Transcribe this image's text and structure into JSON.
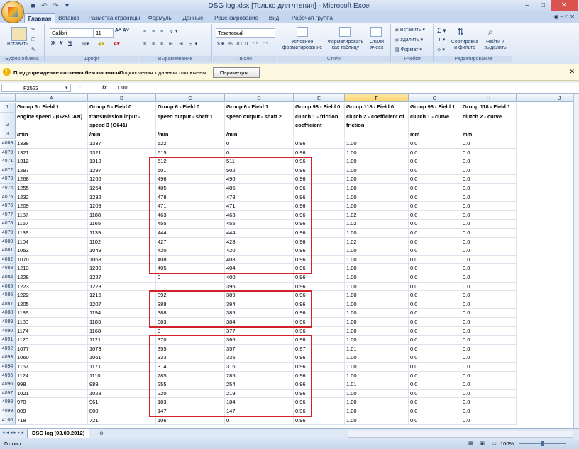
{
  "window": {
    "title": "DSG log.xlsx  [Только для чтения]  -  Microsoft Excel"
  },
  "ribbon_tabs": [
    "Главная",
    "Вставка",
    "Разметка страницы",
    "Формулы",
    "Данные",
    "Рецензирование",
    "Вид",
    "Рабочая группа"
  ],
  "ribbon": {
    "clipboard": {
      "label": "Буфер обмена",
      "paste": "Вставить"
    },
    "font": {
      "label": "Шрифт",
      "name": "Calibri",
      "size": "11"
    },
    "alignment": {
      "label": "Выравнивание"
    },
    "number": {
      "label": "Число",
      "format": "Текстовый"
    },
    "styles": {
      "label": "Стили",
      "cond": "Условное форматирование",
      "table": "Форматировать как таблицу",
      "cell": "Стили ячеек"
    },
    "cells": {
      "label": "Ячейки",
      "insert": "Вставить",
      "delete": "Удалить",
      "format": "Формат"
    },
    "editing": {
      "label": "Редактирование",
      "sort": "Сортировка и фильтр",
      "find": "Найти и выделить"
    }
  },
  "security": {
    "title": "Предупреждение системы безопасности",
    "message": "Подключения к данным отключены",
    "button": "Параметры..."
  },
  "formula_bar": {
    "name_box": "F2523",
    "fx": "fx",
    "value": "1.00"
  },
  "columns": [
    "A",
    "B",
    "C",
    "D",
    "E",
    "F",
    "G",
    "H",
    "I",
    "J"
  ],
  "selected_column": "F",
  "header_rows": {
    "row1": [
      "Group 5 - Field 1",
      "Group 5 - Field 0",
      "Group 6 - Field 0",
      "Group 6 - Field 1",
      "Group 98 - Field 0",
      "Group 118 - Field 0",
      "Group 98 - Field 1",
      "Group 118 - Field 1"
    ],
    "row2": [
      "engine speed -  (G28/CAN)",
      "transmission input - speed 3 (G641)",
      "speed output -  shaft 1",
      "speed output -  shaft 2",
      "clutch 1 -  friction coefficient",
      "clutch 2 -  coefficient of friction",
      "clutch 1 -  curve",
      "clutch 2 -  curve"
    ],
    "row3": [
      "/min",
      "/min",
      "/min",
      "/min",
      "",
      "",
      "mm",
      "mm"
    ]
  },
  "rows": [
    {
      "n": "4069",
      "v": [
        "1338",
        "1337",
        "522",
        "0",
        "0.96",
        "1.00",
        "0.0",
        "0.0"
      ]
    },
    {
      "n": "4070",
      "v": [
        "1321",
        "1321",
        "515",
        "0",
        "0.96",
        "1.00",
        "0.0",
        "0.0"
      ]
    },
    {
      "n": "4071",
      "v": [
        "1312",
        "1313",
        "512",
        "511",
        "0.96",
        "1.00",
        "0.0",
        "0.0"
      ]
    },
    {
      "n": "4072",
      "v": [
        "1297",
        "1297",
        "501",
        "502",
        "0.96",
        "1.00",
        "0.0",
        "0.0"
      ]
    },
    {
      "n": "4073",
      "v": [
        "1268",
        "1266",
        "496",
        "496",
        "0.96",
        "1.00",
        "0.0",
        "0.0"
      ]
    },
    {
      "n": "4074",
      "v": [
        "1255",
        "1254",
        "485",
        "485",
        "0.96",
        "1.00",
        "0.0",
        "0.0"
      ]
    },
    {
      "n": "4075",
      "v": [
        "1232",
        "1232",
        "478",
        "478",
        "0.96",
        "1.00",
        "0.0",
        "0.0"
      ]
    },
    {
      "n": "4076",
      "v": [
        "1209",
        "1209",
        "471",
        "471",
        "0.96",
        "1.00",
        "0.0",
        "0.0"
      ]
    },
    {
      "n": "4077",
      "v": [
        "1187",
        "1188",
        "463",
        "463",
        "0.96",
        "1.02",
        "0.0",
        "0.0"
      ]
    },
    {
      "n": "4078",
      "v": [
        "1167",
        "1165",
        "455",
        "455",
        "0.96",
        "1.02",
        "0.0",
        "0.0"
      ]
    },
    {
      "n": "4079",
      "v": [
        "1139",
        "1139",
        "444",
        "444",
        "0.96",
        "1.00",
        "0.0",
        "0.0"
      ]
    },
    {
      "n": "4080",
      "v": [
        "1104",
        "1102",
        "427",
        "428",
        "0.96",
        "1.02",
        "0.0",
        "0.0"
      ]
    },
    {
      "n": "4081",
      "v": [
        "1053",
        "1049",
        "420",
        "420",
        "0.96",
        "1.00",
        "0.0",
        "0.0"
      ]
    },
    {
      "n": "4082",
      "v": [
        "1070",
        "1068",
        "408",
        "408",
        "0.96",
        "1.00",
        "0.0",
        "0.0"
      ]
    },
    {
      "n": "4083",
      "v": [
        "1213",
        "1230",
        "405",
        "404",
        "0.96",
        "1.00",
        "0.0",
        "0.0"
      ]
    },
    {
      "n": "4084",
      "v": [
        "1228",
        "1227",
        "0",
        "400",
        "0.96",
        "1.00",
        "0.0",
        "0.0"
      ]
    },
    {
      "n": "4085",
      "v": [
        "1223",
        "1223",
        "0",
        "395",
        "0.96",
        "1.00",
        "0.0",
        "0.0"
      ]
    },
    {
      "n": "4086",
      "v": [
        "1222",
        "1216",
        "392",
        "389",
        "0.96",
        "1.00",
        "0.0",
        "0.0"
      ]
    },
    {
      "n": "4087",
      "v": [
        "1205",
        "1207",
        "388",
        "394",
        "0.96",
        "1.00",
        "0.0",
        "0.0"
      ]
    },
    {
      "n": "4088",
      "v": [
        "1189",
        "1194",
        "388",
        "385",
        "0.96",
        "1.00",
        "0.0",
        "0.0"
      ]
    },
    {
      "n": "4089",
      "v": [
        "1183",
        "1183",
        "383",
        "384",
        "0.96",
        "1.00",
        "0.0",
        "0.0"
      ]
    },
    {
      "n": "4090",
      "v": [
        "1174",
        "1168",
        "0",
        "377",
        "0.96",
        "1.00",
        "0.0",
        "0.0"
      ]
    },
    {
      "n": "4091",
      "v": [
        "1120",
        "1121",
        "370",
        "366",
        "0.96",
        "1.00",
        "0.0",
        "0.0"
      ]
    },
    {
      "n": "4092",
      "v": [
        "1077",
        "1078",
        "355",
        "357",
        "0.97",
        "1.01",
        "0.0",
        "0.0"
      ]
    },
    {
      "n": "4093",
      "v": [
        "1060",
        "1061",
        "333",
        "335",
        "0.96",
        "1.00",
        "0.0",
        "0.0"
      ]
    },
    {
      "n": "4094",
      "v": [
        "1167",
        "1171",
        "314",
        "316",
        "0.96",
        "1.00",
        "0.0",
        "0.0"
      ]
    },
    {
      "n": "4095",
      "v": [
        "1124",
        "1110",
        "285",
        "285",
        "0.96",
        "1.00",
        "0.0",
        "0.0"
      ]
    },
    {
      "n": "4096",
      "v": [
        "998",
        "989",
        "255",
        "254",
        "0.96",
        "1.01",
        "0.0",
        "0.0"
      ]
    },
    {
      "n": "4097",
      "v": [
        "1021",
        "1028",
        "220",
        "219",
        "0.96",
        "1.00",
        "0.0",
        "0.0"
      ]
    },
    {
      "n": "4098",
      "v": [
        "970",
        "961",
        "183",
        "184",
        "0.96",
        "1.00",
        "0.0",
        "0.0"
      ]
    },
    {
      "n": "4099",
      "v": [
        "809",
        "800",
        "147",
        "147",
        "0.96",
        "1.00",
        "0.0",
        "0.0"
      ]
    },
    {
      "n": "4100",
      "v": [
        "718",
        "721",
        "106",
        "0",
        "0.96",
        "1.00",
        "0.0",
        "0.0"
      ]
    }
  ],
  "sheet_tab": "DSG log (03.09.2012)",
  "status": {
    "ready": "Готово",
    "zoom": "100%"
  }
}
